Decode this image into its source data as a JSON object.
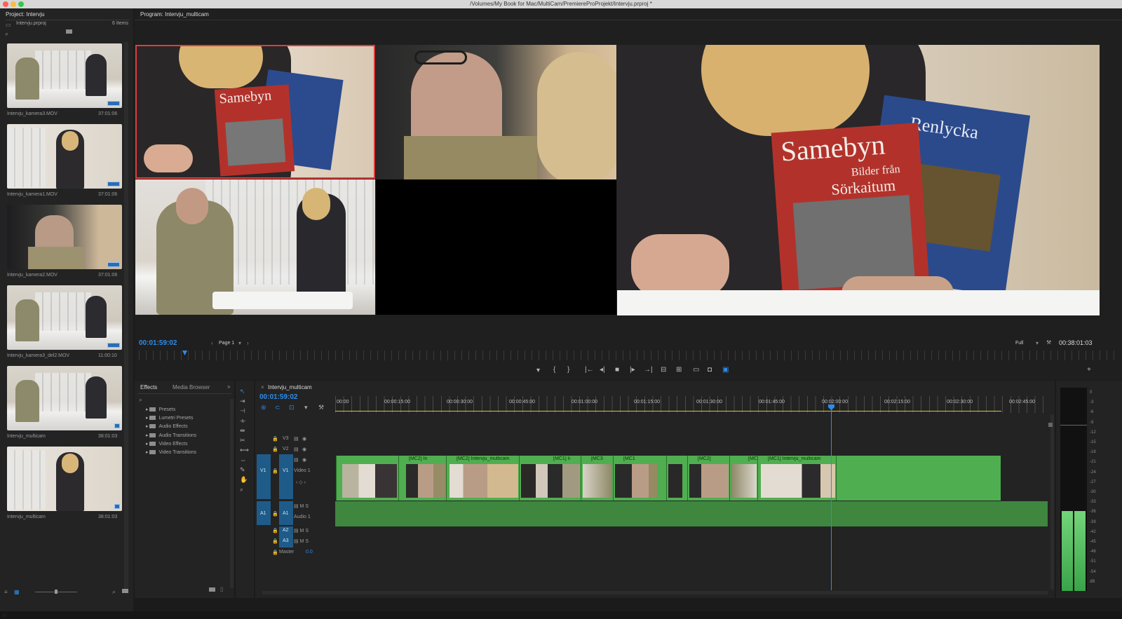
{
  "window": {
    "title": "/Volumes/My Book for Mac/MultiCam/PremiereProProjekt/Intervju.prproj *"
  },
  "project": {
    "panel_title": "Project: Intervju",
    "file": "Intervju.prproj",
    "item_count": "6 Items",
    "items": [
      {
        "name": "Intervju_kamera3.MOV",
        "duration": "37:01:06"
      },
      {
        "name": "Intervju_kamera1.MOV",
        "duration": "37:01:06"
      },
      {
        "name": "Intervju_kamera2.MOV",
        "duration": "37:01:06"
      },
      {
        "name": "Intervju_kamera3_del2.MOV",
        "duration": "11:00:10"
      },
      {
        "name": "Intervju_multicam",
        "duration": "38:01:03"
      },
      {
        "name": "Intervju_multicam",
        "duration": "38:01:03"
      }
    ]
  },
  "program": {
    "panel_title": "Program: Intervju_multicam",
    "timecode": "00:01:59:02",
    "page": "Page 1",
    "quality": "Full",
    "duration": "00:38:01:03",
    "book_title": "Samebyn",
    "book_subtitle_1": "Bilder från",
    "book_subtitle_2": "Sörkaitum",
    "book2_title": "Renlycka"
  },
  "effects": {
    "tabs": [
      "Effects",
      "Media Browser"
    ],
    "folders": [
      "Presets",
      "Lumetri Presets",
      "Audio Effects",
      "Audio Transitions",
      "Video Effects",
      "Video Transitions"
    ]
  },
  "timeline": {
    "tab": "Intervju_multicam",
    "timecode": "00:01:59:02",
    "ruler": [
      "00:00",
      "00:00:15:00",
      "00:00:30:00",
      "00:00:45:00",
      "00:01:00:00",
      "00:01:15:00",
      "00:01:30:00",
      "00:01:45:00",
      "00:02:00:00",
      "00:02:15:00",
      "00:02:30:00",
      "00:02:45:00"
    ],
    "video_tracks": [
      "V3",
      "V2",
      "V1"
    ],
    "video1_name": "Video 1",
    "audio_tracks": [
      "A1",
      "A2",
      "A3"
    ],
    "audio1_name": "Audio 1",
    "master": "Master",
    "master_value": "0.0",
    "clips": [
      "[MC2] In",
      "[MC2] Intervju_multicam",
      "[MC1] Ii",
      "[MC3",
      "[MC1",
      "[MC2]",
      "[MC",
      "[MC1] Intervju_multicam"
    ]
  },
  "meter": {
    "scale": [
      "0",
      "-3",
      "-6",
      "-9",
      "-12",
      "-15",
      "-18",
      "-21",
      "-24",
      "-27",
      "-30",
      "-33",
      "-36",
      "-39",
      "-42",
      "-45",
      "-48",
      "-51",
      "-54",
      "dB"
    ]
  },
  "colors": {
    "accent": "#2d8ceb",
    "clip": "#4fae4f",
    "selection": "#e23c3c"
  }
}
